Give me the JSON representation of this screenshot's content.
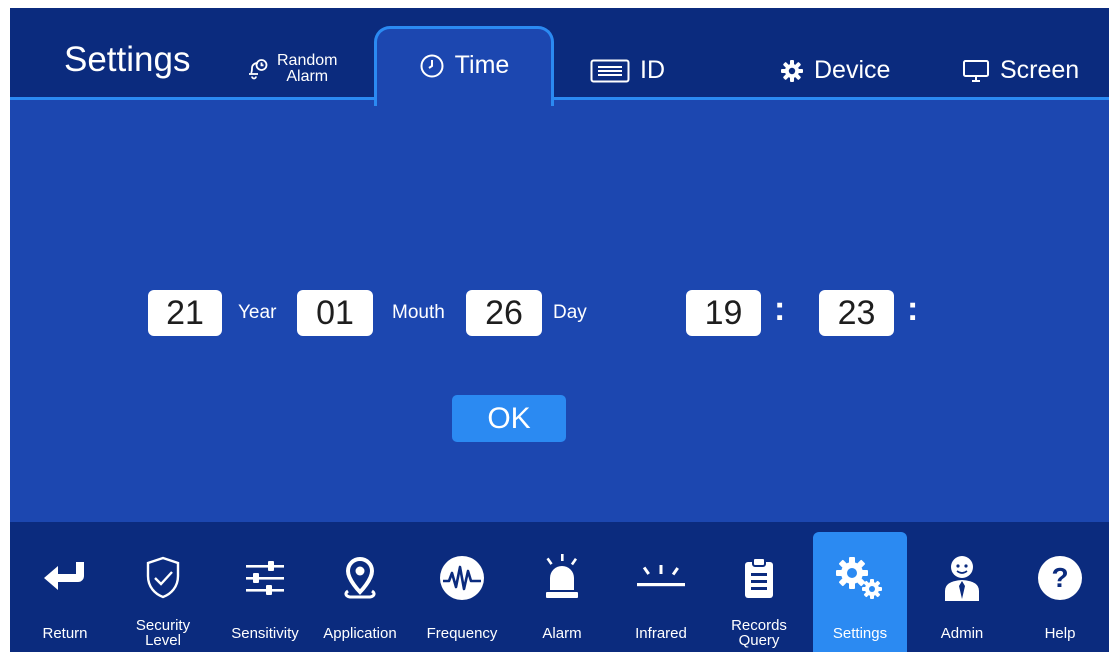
{
  "header": {
    "title": "Settings",
    "tabs": [
      {
        "label_line1": "Random",
        "label_line2": "Alarm",
        "icon": "alarm-clock-bell-icon"
      },
      {
        "label": "Time",
        "icon": "clock-icon",
        "active": true
      },
      {
        "label": "ID",
        "icon": "id-card-icon"
      },
      {
        "label": "Device",
        "icon": "gear-icon"
      },
      {
        "label": "Screen",
        "icon": "monitor-icon"
      }
    ]
  },
  "time_editor": {
    "year": "21",
    "year_unit": "Year",
    "month": "01",
    "month_unit": "Mouth",
    "day": "26",
    "day_unit": "Day",
    "hour": "19",
    "minute": "23",
    "separator": ":",
    "ok_label": "OK"
  },
  "bottom_nav": {
    "items": [
      {
        "label": "Return",
        "icon": "return-arrow-icon"
      },
      {
        "label_line1": "Security",
        "label_line2": "Level",
        "icon": "shield-check-icon"
      },
      {
        "label": "Sensitivity",
        "icon": "sliders-icon"
      },
      {
        "label": "Application",
        "icon": "location-pin-icon"
      },
      {
        "label": "Frequency",
        "icon": "waveform-icon"
      },
      {
        "label": "Alarm",
        "icon": "alarm-siren-icon"
      },
      {
        "label": "Infrared",
        "icon": "infrared-icon"
      },
      {
        "label_line1": "Records",
        "label_line2": "Query",
        "icon": "clipboard-icon"
      },
      {
        "label": "Settings",
        "icon": "gears-icon",
        "active": true
      },
      {
        "label": "Admin",
        "icon": "admin-person-icon"
      },
      {
        "label": "Help",
        "icon": "help-icon"
      }
    ]
  },
  "colors": {
    "background": "#1c47b0",
    "bar": "#0b2b7e",
    "accent": "#2b8af2",
    "field": "#ffffff"
  }
}
